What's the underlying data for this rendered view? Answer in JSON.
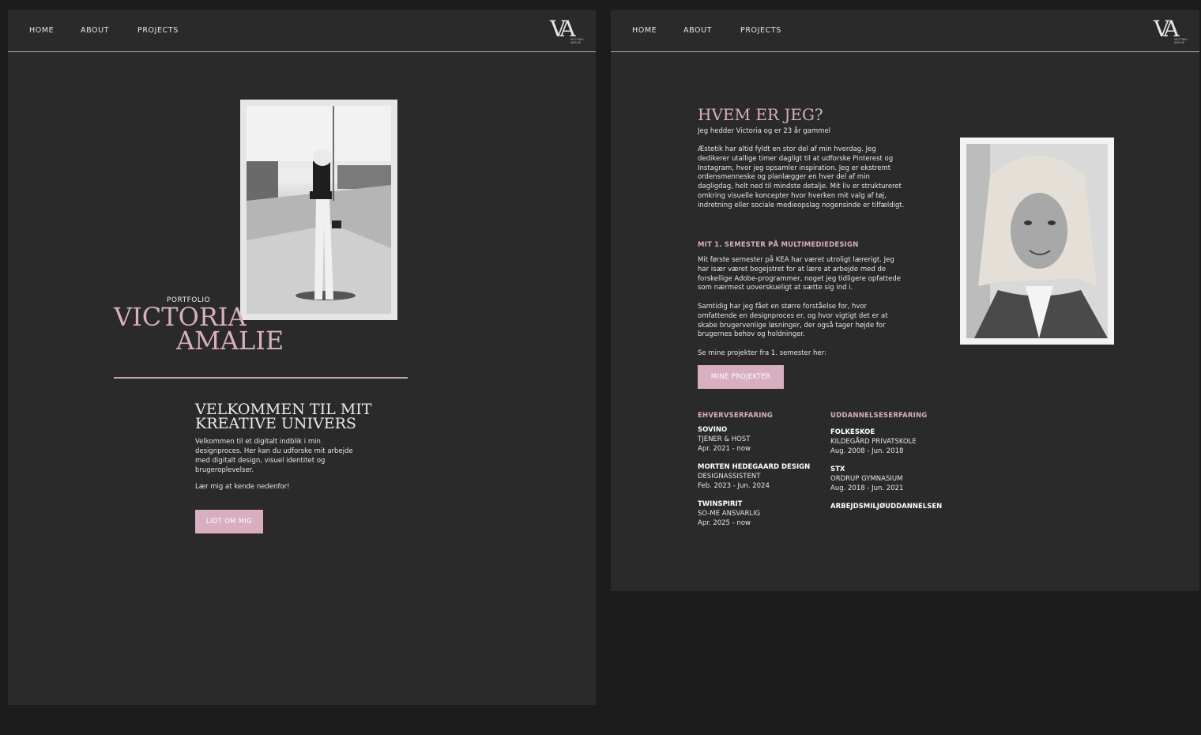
{
  "nav": {
    "home": "HOME",
    "about": "ABOUT",
    "projects": "PROJECTS"
  },
  "logo": {
    "mark": "VA",
    "sub": "VICTORIA AMALIE"
  },
  "home": {
    "portfolio_label": "PORTFOLIO",
    "name_line1": "VICTORIA",
    "name_line2": "AMALIE",
    "welcome_title": "VELKOMMEN TIL MIT KREATIVE UNIVERS",
    "welcome_body": "Velkommen til et digitalt indblik i min designproces. Her kan du udforske mit arbejde med digitalt design, visuel identitet og brugeroplevelser.",
    "welcome_cta": "Lær mig at kende nedenfor!",
    "button_label": "LIDT OM MIG"
  },
  "about": {
    "title": "HVEM ER JEG?",
    "intro": "Jeg hedder Victoria og er 23 år gammel",
    "p1": "Æstetik har altid fyldt en stor del af min hverdag. Jeg dedikerer utallige timer dagligt til at udforske Pinterest og Instagram, hvor jeg opsamler inspiration. Jeg er ekstremt ordensmenneske og planlægger en hver del af min dagligdag, helt ned til mindste detalje. Mit liv er struktureret omkring visuelle koncepter hvor hverken mit valg af tøj, indretning eller sociale medieopslag nogensinde er tilfældigt.",
    "semester_heading": "MIT 1. SEMESTER PÅ MULTIMEDIEDESIGN",
    "p2": "Mit første semester på KEA har været utroligt lærerigt. Jeg har især været begejstret for at lære at arbejde med de forskellige Adobe-programmer, noget jeg tidligere opfattede som nærmest uoverskueligt at sætte sig ind i.",
    "p3": "Samtidig har jeg fået en større forståelse for, hvor omfattende en designproces er, og hvor vigtigt det er at skabe brugervenlige løsninger, der også tager højde for brugernes behov og holdninger.",
    "p4": "Se mine projekter fra 1. semester her:",
    "button_label": "MINE PROJEKTER",
    "experience_heading": "EHVERVSERFARING",
    "experience": [
      {
        "title": "SOVINO",
        "role": "TJENER & HOST",
        "period": "Apr. 2021 - now"
      },
      {
        "title": "MORTEN HEDEGAARD DESIGN",
        "role": "DESIGNASSISTENT",
        "period": "Feb. 2023 - Jun. 2024"
      },
      {
        "title": "TWINSPIRIT",
        "role": "SO-ME ANSVARLIG",
        "period": "Apr. 2025 - now"
      }
    ],
    "education_heading": "UDDANNELSESERFARING",
    "education": [
      {
        "title": "FOLKESKOE",
        "role": "KILDEGÅRD PRIVATSKOLE",
        "period": "Aug. 2008 - Jun. 2018"
      },
      {
        "title": "STX",
        "role": "ORDRUP GYMNASIUM",
        "period": "Aug. 2018 - Jun. 2021"
      },
      {
        "title": "ARBEJDSMILJØUDDANNELSEN",
        "role": "",
        "period": ""
      }
    ]
  }
}
